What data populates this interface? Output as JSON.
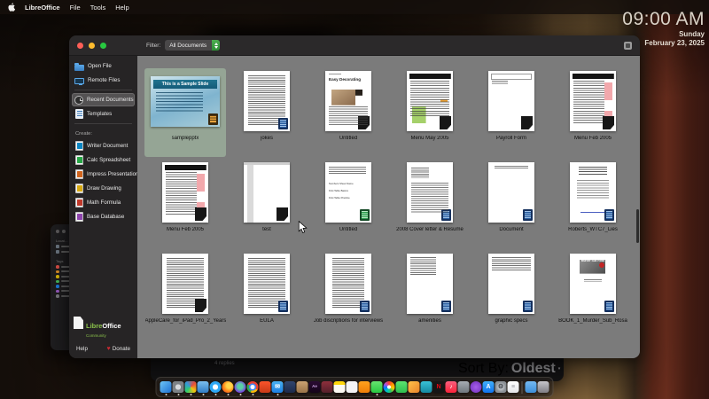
{
  "menu_bar": {
    "app": "LibreOffice",
    "items": [
      "File",
      "Tools",
      "Help"
    ]
  },
  "clock": {
    "time": "09:00 AM",
    "day": "Sunday",
    "date": "February 23, 2025"
  },
  "start_center": {
    "filter_label": "Filter:",
    "filter_value": "All Documents",
    "sidebar": {
      "items": [
        {
          "label": "Open File",
          "icon": "folder-icon",
          "selected": false,
          "divider_after": false
        },
        {
          "label": "Remote Files",
          "icon": "remote-icon",
          "selected": false,
          "divider_after": true
        },
        {
          "label": "Recent Documents",
          "icon": "clock-icon",
          "selected": true,
          "divider_after": false
        },
        {
          "label": "Templates",
          "icon": "templates-icon",
          "selected": false,
          "divider_after": true
        }
      ],
      "create_label": "Create:",
      "create_items": [
        {
          "label": "Writer Document",
          "color": "#0a85c2"
        },
        {
          "label": "Calc Spreadsheet",
          "color": "#27a746"
        },
        {
          "label": "Impress Presentation",
          "color": "#d0641d"
        },
        {
          "label": "Draw Drawing",
          "color": "#d6a811"
        },
        {
          "label": "Math Formula",
          "color": "#c0392b"
        },
        {
          "label": "Base Database",
          "color": "#8e44ad"
        }
      ],
      "logo": {
        "libre": "Libre",
        "office": "Office",
        "community": "Community"
      },
      "help_label": "Help",
      "donate_label": "Donate"
    },
    "documents": [
      {
        "name": "samplepptx",
        "badge": "impress",
        "style": "slide",
        "selected": true,
        "title": "This is a Sample Slide"
      },
      {
        "name": "jokes",
        "badge": "writer",
        "style": "dense"
      },
      {
        "name": "Untitled",
        "badge": "plain",
        "style": "decor",
        "title": "Easy Decorating"
      },
      {
        "name": "Menu May 2005",
        "badge": "plain",
        "style": "menu-green"
      },
      {
        "name": "Payroll Form",
        "badge": "plain",
        "style": "payroll"
      },
      {
        "name": "Menu Feb 2005",
        "badge": "plain",
        "style": "menu-pink"
      },
      {
        "name": "Menu Feb 2005",
        "badge": "plain",
        "style": "menu-pink"
      },
      {
        "name": "test",
        "badge": "plain",
        "style": "testdoc"
      },
      {
        "name": "Untitled",
        "badge": "calc",
        "style": "numbers",
        "lines": [
          "Numbers Sheet Name",
          "First Table Basics",
          "First Table Practice"
        ]
      },
      {
        "name": "2008 Cover letter & Resume",
        "badge": "writer",
        "style": "letter"
      },
      {
        "name": "Document",
        "badge": "writer",
        "style": "blankdoc"
      },
      {
        "name": "Roberts_WTC7_Lies",
        "badge": "writer",
        "style": "centered"
      },
      {
        "name": "AppleCare_for_iPad_Pro_2_Years",
        "badge": "plain",
        "style": "dense"
      },
      {
        "name": "EULA",
        "badge": "writer",
        "style": "dense"
      },
      {
        "name": "Job discriptions for interviews",
        "badge": "writer",
        "style": "dense-centered"
      },
      {
        "name": "amenities",
        "badge": "writer",
        "style": "amenities"
      },
      {
        "name": "graphic specs",
        "badge": "writer",
        "style": "specs"
      },
      {
        "name": "BOOK_1_Murder_Sub_Rosa",
        "badge": "writer",
        "style": "murder",
        "title": "Murder Sub Rosa"
      }
    ]
  },
  "background_window": {
    "replies": "4 replies",
    "sort_label": "Sort By:",
    "sort_value": "Oldest"
  },
  "finder_fragment": {
    "tag_colors": [
      "#ff5c52",
      "#ffa52e",
      "#ffd60a",
      "#53d769",
      "#1f8fff",
      "#b36ae2",
      "#8e8e93"
    ]
  },
  "dock": {
    "items": [
      {
        "name": "finder",
        "bg": "linear-gradient(135deg,#6ec6f7,#1d6fd1)",
        "running": true
      },
      {
        "name": "launchpad",
        "bg": "radial-gradient(circle at 50% 50%,#d7dadd 0 34%,#7d8286 35%)",
        "running": true
      },
      {
        "name": "media-grid",
        "bg": "conic-gradient(from 45deg,#e74c3c,#f1c40f,#2ecc71,#3498db,#e74c3c)",
        "running": true
      },
      {
        "name": "preview",
        "bg": "linear-gradient(#7cc0ef,#2f7cc4)",
        "running": true
      },
      {
        "name": "safari",
        "bg": "radial-gradient(circle at 50% 50%,#fff 0 34%,#2da8f5 35%)",
        "running": true,
        "round": true
      },
      {
        "name": "firefox",
        "bg": "radial-gradient(circle at 62% 38%,#ffd54a 0 25%,#ff8a18 55%,#e3392b)",
        "running": true,
        "round": true
      },
      {
        "name": "tor-browser",
        "bg": "radial-gradient(circle at 50% 45%,#59d0a5 0 30%,#7a3fe0 70%,#431d86)",
        "running": true,
        "round": true
      },
      {
        "name": "chrome",
        "bg": "radial-gradient(circle at 50% 50%,#fff 0 2.5px,#4285f4 2.5px 4px,transparent 4px),conic-gradient(#ea4335 0 120deg,#fbbc05 120deg 200deg,#34a853 200deg 300deg,#ea4335 300deg)",
        "running": true,
        "round": true
      },
      {
        "name": "brave",
        "bg": "linear-gradient(#fb542b,#c93a17)"
      },
      {
        "name": "mail",
        "bg": "linear-gradient(#49b1f3,#1c7fe2)",
        "glyph": "✉",
        "glyph_color": "#ffffff",
        "running": true
      },
      {
        "name": "navy-app",
        "bg": "linear-gradient(#31456e,#1c2a4a)"
      },
      {
        "name": "files",
        "bg": "linear-gradient(#caa272,#9a7448)"
      },
      {
        "name": "after-effects",
        "bg": "linear-gradient(#2b0b33,#150519)",
        "glyph": "Ae",
        "glyph_color": "#cfa6e8"
      },
      {
        "name": "photos-dark",
        "bg": "linear-gradient(#8e2f3c,#54202a)"
      },
      {
        "name": "notes",
        "bg": "linear-gradient(#ffd60a 0 32%,#fbf9f2 32%)"
      },
      {
        "name": "reminders",
        "bg": "#f4f4f6"
      },
      {
        "name": "orange-utility",
        "bg": "linear-gradient(#ffa21f,#ef7e06)"
      },
      {
        "name": "messages",
        "bg": "linear-gradient(#67e46f,#28c840)",
        "running": true
      },
      {
        "name": "photos",
        "bg": "radial-gradient(circle,#fff 0 2px,transparent 2.2px),conic-gradient(#ff3b30,#ff9500,#ffcc00,#34c759,#00c7be,#007aff,#af52de,#ff3b30)",
        "round": true
      },
      {
        "name": "facetime",
        "bg": "linear-gradient(#5be370,#2fbf4e)"
      },
      {
        "name": "pencil-editor",
        "bg": "linear-gradient(135deg,#ffc24a,#e8842a)"
      },
      {
        "name": "teal-app",
        "bg": "linear-gradient(#39c2d7,#1489a0)"
      },
      {
        "name": "netflix",
        "bg": "#161616",
        "glyph": "N",
        "glyph_color": "#e50914"
      },
      {
        "name": "music",
        "bg": "linear-gradient(#fb5f7e,#f92339)",
        "glyph": "♪",
        "glyph_color": "#ffffff"
      },
      {
        "name": "gray-utility",
        "bg": "linear-gradient(#a7adb3,#70777e)"
      },
      {
        "name": "purple-app",
        "bg": "radial-gradient(circle,#a55eea,#6f2dba)",
        "round": true
      },
      {
        "name": "app-store",
        "bg": "linear-gradient(#41b0fc,#0f73ee)",
        "glyph": "A",
        "glyph_color": "#ffffff"
      },
      {
        "name": "system-settings",
        "bg": "radial-gradient(circle,#c9ccd1 0 20%,#8c9196 60%)",
        "glyph": "⚙",
        "glyph_color": "#3a3f45"
      },
      {
        "name": "notes-white",
        "bg": "linear-gradient(#ffffff,#e6e6e9)",
        "glyph": "≡",
        "glyph_color": "#9a9aa0"
      },
      {
        "name": "divider",
        "kind": "divider"
      },
      {
        "name": "downloads-folder",
        "bg": "linear-gradient(#74b9f2,#3e8fd9)"
      },
      {
        "name": "trash",
        "bg": "linear-gradient(rgba(215,215,222,.9),rgba(140,140,150,.85))"
      }
    ]
  }
}
